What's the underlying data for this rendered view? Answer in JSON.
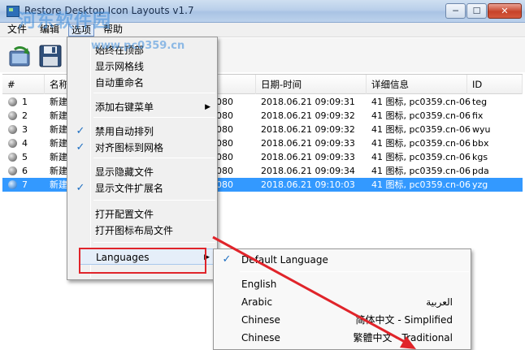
{
  "window": {
    "title": "Restore Desktop Icon Layouts v1.7",
    "controls": {
      "minimize": "─",
      "maximize": "☐",
      "close": "✕"
    }
  },
  "menubar": [
    "文件",
    "编辑",
    "选项",
    "帮助"
  ],
  "toolbar": {
    "refresh_icon": "refresh-icon",
    "save_icon": "save-icon"
  },
  "list": {
    "columns": [
      "#",
      "名称",
      "",
      "日期-时间",
      "详细信息",
      "ID"
    ],
    "rows": [
      {
        "num": "1",
        "name": "新建",
        "res": "080",
        "datetime": "2018.06.21 09:09:31",
        "details": "41 图标, pc0359.cn-06",
        "id": "teg"
      },
      {
        "num": "2",
        "name": "新建",
        "res": "080",
        "datetime": "2018.06.21 09:09:32",
        "details": "41 图标, pc0359.cn-06",
        "id": "fix"
      },
      {
        "num": "3",
        "name": "新建",
        "res": "080",
        "datetime": "2018.06.21 09:09:32",
        "details": "41 图标, pc0359.cn-06",
        "id": "wyu"
      },
      {
        "num": "4",
        "name": "新建",
        "res": "080",
        "datetime": "2018.06.21 09:09:33",
        "details": "41 图标, pc0359.cn-06",
        "id": "bbx"
      },
      {
        "num": "5",
        "name": "新建",
        "res": "080",
        "datetime": "2018.06.21 09:09:33",
        "details": "41 图标, pc0359.cn-06",
        "id": "kgs"
      },
      {
        "num": "6",
        "name": "新建",
        "res": "080",
        "datetime": "2018.06.21 09:09:34",
        "details": "41 图标, pc0359.cn-06",
        "id": "pda"
      },
      {
        "num": "7",
        "name": "新建",
        "res": "080",
        "datetime": "2018.06.21 09:10:03",
        "details": "41 图标, pc0359.cn-06",
        "id": "yzg"
      }
    ],
    "selected_row": 7
  },
  "options_menu": {
    "items": [
      {
        "label": "始终在顶部"
      },
      {
        "label": "显示网格线"
      },
      {
        "label": "自动重命名"
      },
      {
        "label": "添加右键菜单"
      },
      {
        "label": "禁用自动排列",
        "checked": true
      },
      {
        "label": "对齐图标到网格",
        "checked": true
      },
      {
        "label": "显示隐藏文件"
      },
      {
        "label": "显示文件扩展名",
        "checked": true
      },
      {
        "label": "打开配置文件"
      },
      {
        "label": "打开图标布局文件"
      },
      {
        "label": "Languages"
      }
    ],
    "check_mark": "✓",
    "submenu_arrow": "▶"
  },
  "language_menu": {
    "items": [
      {
        "name": "Default Language",
        "native": "",
        "checked": true
      },
      {
        "name": "English",
        "native": ""
      },
      {
        "name": "Arabic",
        "native": "العربية"
      },
      {
        "name": "Chinese",
        "native": "简体中文 - Simplified"
      },
      {
        "name": "Chinese",
        "native": "繁體中文 - Traditional"
      }
    ]
  },
  "watermark": {
    "text": "河东软件园",
    "url": "www.pc0359.cn"
  },
  "colors": {
    "selection": "#3399ff",
    "annotation": "#e0242a",
    "check": "#1e6fc2"
  }
}
